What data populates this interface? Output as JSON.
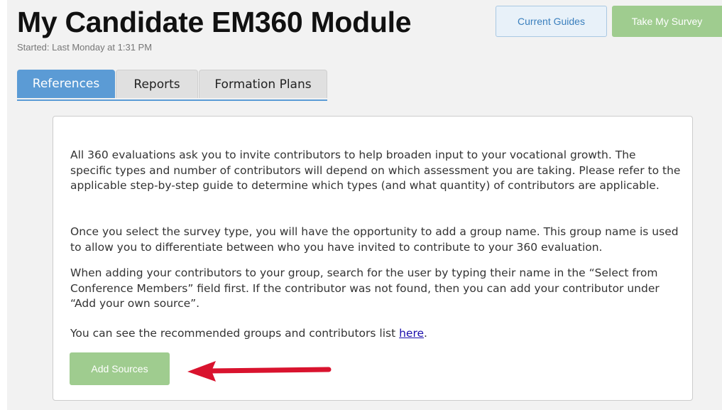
{
  "header": {
    "title": "My Candidate EM360 Module",
    "started": "Started: Last Monday at 1:31 PM",
    "current_guides_label": "Current Guides",
    "take_survey_label": "Take My Survey"
  },
  "tabs": [
    {
      "label": "References",
      "active": true
    },
    {
      "label": "Reports",
      "active": false
    },
    {
      "label": "Formation Plans",
      "active": false
    }
  ],
  "content": {
    "paragraphs": [
      "All 360 evaluations ask you to invite contributors to help broaden input to your vocational growth. The specific types and number of contributors will depend on which assessment you are taking. Please refer to the applicable step-by-step guide to determine which types (and what quantity) of contributors are applicable.",
      "Once you select the survey type, you will have the opportunity to add a group name. This group name is used to allow you to differentiate between who you have invited to contribute to your 360 evaluation.",
      "When adding your contributors to your group, search for the user by typing their name in the “Select from Conference Members” field first. If the contributor was not found, then you can add your contributor under “Add your own source”."
    ],
    "recommended_text": "You can see the recommended groups and contributors list ",
    "here_link": "here",
    "recommended_end": ".",
    "add_sources_label": "Add Sources"
  },
  "colors": {
    "tab_active": "#5b9bd5",
    "green_button": "#9fcc8f",
    "arrow": "#d9132e"
  }
}
